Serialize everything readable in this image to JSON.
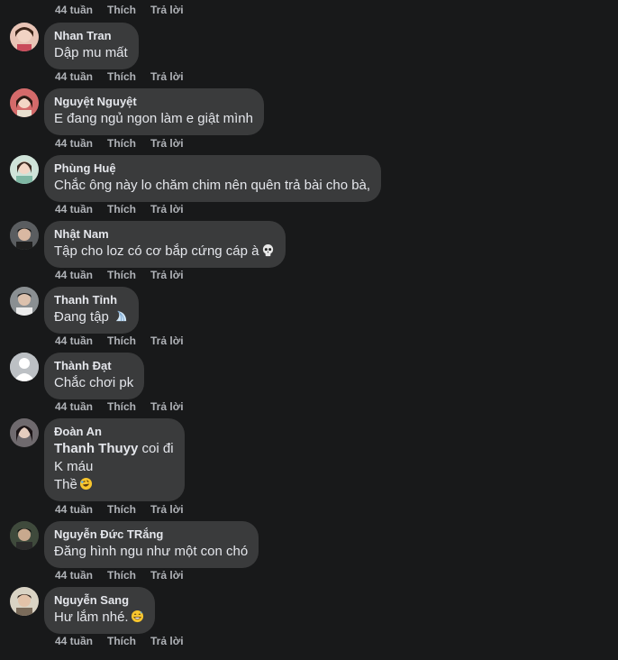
{
  "actions": {
    "time": "44 tuần",
    "like": "Thích",
    "reply": "Trả lời"
  },
  "comments": [
    {
      "author": "Nhan Tran",
      "text": "Dập mu mất"
    },
    {
      "author": "Nguyệt Nguyệt",
      "text": "E đang ngủ ngon làm e giật mình"
    },
    {
      "author": "Phùng Huệ",
      "text": "Chắc ông này lo chăm chim nên quên trả bài cho bà,"
    },
    {
      "author": "Nhật Nam",
      "text": "Tập cho loz có cơ bắp cứng cáp à",
      "emoji": "skull-emoji"
    },
    {
      "author": "Thanh Tỉnh",
      "text": "Đang tập",
      "emoji": "shell-emoji"
    },
    {
      "author": "Thành Đạt",
      "text": "Chắc chơi pk"
    },
    {
      "author": "Đoàn An",
      "mention": "Thanh Thuyy",
      "text": " coi đi",
      "line2": "K máu",
      "line3": "Thề",
      "emoji": "rolling-laugh-emoji"
    },
    {
      "author": "Nguyễn Đức TRắng",
      "text": "Đăng hình ngu như một con chó"
    },
    {
      "author": "Nguyễn Sang",
      "text": "Hư lắm nhé.",
      "emoji": "grin-sweat-emoji"
    }
  ],
  "colors": {
    "background": "#18191a",
    "bubble": "#3a3b3c",
    "text": "#e4e6eb",
    "secondary": "#b0b3b8"
  }
}
